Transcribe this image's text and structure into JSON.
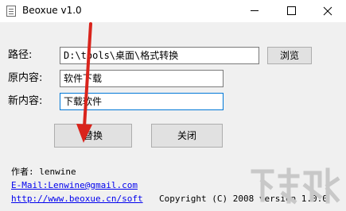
{
  "window": {
    "title": "Beoxue v1.0",
    "icon": "app-document-icon",
    "min_icon": "minimize-icon",
    "max_icon": "maximize-icon",
    "close_icon": "close-icon"
  },
  "form": {
    "path_label": "路径:",
    "path_value": "D:\\tools\\桌面\\格式转换",
    "browse_label": "浏览",
    "original_label": "原内容:",
    "original_value": "软件下载",
    "new_label": "新内容:",
    "new_value": "下载软件"
  },
  "actions": {
    "replace_label": "替换",
    "close_label": "关闭"
  },
  "credits": {
    "author": "作者: lenwine",
    "email": "E-Mail:Lenwine@gmail.com",
    "website": "http://www.beoxue.cn/soft",
    "copyright": "Copyright (C) 2008 version 1.0.0"
  },
  "annotation": {
    "color": "#d9241c",
    "arrow_icon": "red-arrow-annotation"
  }
}
